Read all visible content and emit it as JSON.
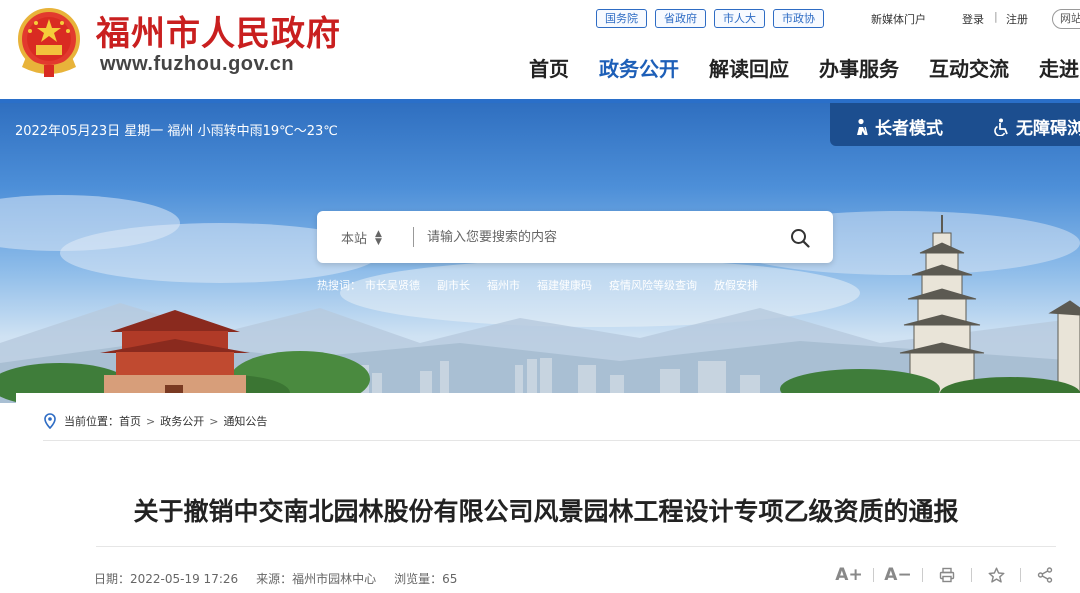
{
  "header": {
    "site_name": "福州市人民政府",
    "site_url": "www.fuzhou.gov.cn",
    "top_links": [
      "国务院",
      "省政府",
      "市人大",
      "市政协"
    ],
    "media_link": "新媒体门户",
    "login": "登录",
    "separator": "|",
    "register": "注册",
    "netlink": "网站",
    "nav": [
      {
        "label": "首页",
        "active": false
      },
      {
        "label": "政务公开",
        "active": true
      },
      {
        "label": "解读回应",
        "active": false
      },
      {
        "label": "办事服务",
        "active": false
      },
      {
        "label": "互动交流",
        "active": false
      },
      {
        "label": "走进",
        "active": false
      }
    ]
  },
  "banner": {
    "weather": "2022年05月23日 星期一 福州 小雨转中雨19℃～23℃",
    "elder_mode": "长者模式",
    "accessible_mode": "无障碍浏",
    "search": {
      "scope": "本站",
      "placeholder": "请输入您要搜索的内容"
    },
    "hot_label": "热搜词：",
    "hot_words": [
      "市长吴贤德",
      "副市长",
      "福州市",
      "福建健康码",
      "疫情风险等级查询",
      "放假安排"
    ]
  },
  "article": {
    "breadcrumb_label": "当前位置：",
    "breadcrumb": [
      "首页",
      "政务公开",
      "通知公告"
    ],
    "breadcrumb_sep": ">",
    "title": "关于撤销中交南北园林股份有限公司风景园林工程设计专项乙级资质的通报",
    "date": "日期：2022-05-19 17:26",
    "source": "来源：福州市园林中心",
    "views": "浏览量：65",
    "font_increase": "A+",
    "font_decrease": "A−"
  },
  "colors": {
    "brand_red": "#c91f1f",
    "nav_active": "#1d5fb8",
    "nav_line": "#2a6fc9",
    "access_bar": "#1c4e8f"
  },
  "icons": [
    "national-emblem-icon",
    "elder-icon",
    "wheelchair-icon",
    "search-icon",
    "location-pin-icon",
    "print-icon",
    "star-icon",
    "share-icon"
  ]
}
